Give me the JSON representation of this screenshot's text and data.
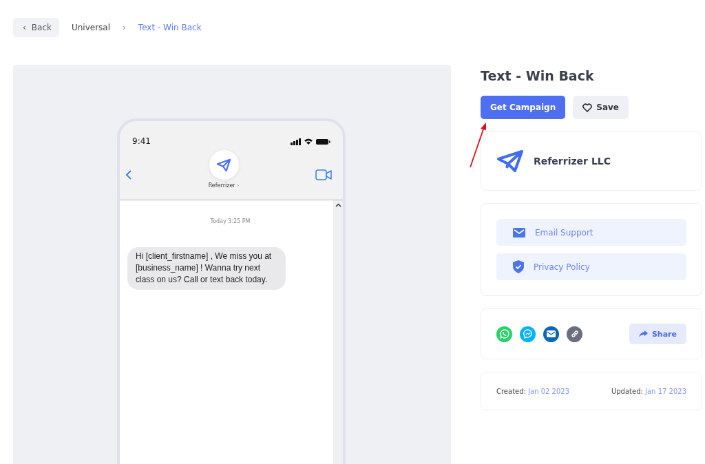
{
  "back_button": {
    "label": "Back",
    "icon": "‹"
  },
  "breadcrumbs": [
    {
      "label": "Universal",
      "current": false
    },
    {
      "label": "Text - Win Back",
      "current": true
    }
  ],
  "breadcrumb_separator": "›",
  "phone": {
    "time": "9:41",
    "contact": "Referrizer",
    "contact_chevron": "›",
    "timestamp": "Today 3:25 PM",
    "message": "Hi [client_firstname] , We miss you at [business_name] ! Wanna try next class on us? Call or text back today."
  },
  "title": "Text - Win Back",
  "actions": [
    {
      "kind": "primary",
      "label": "Get Campaign"
    },
    {
      "kind": "save",
      "label": "Save"
    }
  ],
  "annotation_arrow": true,
  "company": {
    "name": "Referrizer LLC"
  },
  "links": [
    {
      "kind": "email",
      "label": "Email Support"
    },
    {
      "kind": "privacy",
      "label": "Privacy Policy"
    }
  ],
  "share_channels": [
    {
      "kind": "whatsapp",
      "color": "#25d366"
    },
    {
      "kind": "messenger",
      "color": "#00b2ff"
    },
    {
      "kind": "email",
      "color": "#0a66b7"
    },
    {
      "kind": "link",
      "color": "#6b6e7e"
    }
  ],
  "share_button": {
    "label": "Share"
  },
  "dates": [
    {
      "label": "Created:",
      "value": "Jan 02 2023"
    },
    {
      "label": "Updated:",
      "value": "Jan 17 2023"
    }
  ]
}
